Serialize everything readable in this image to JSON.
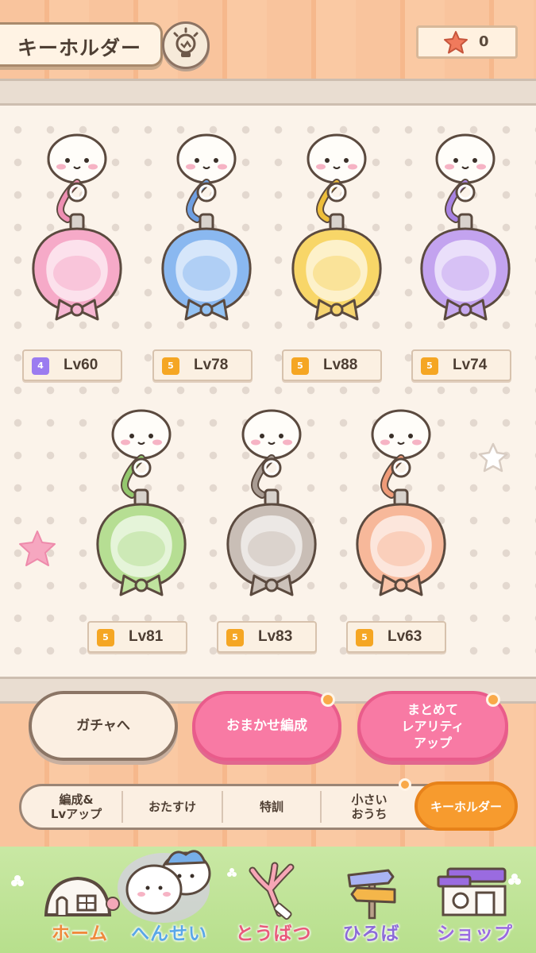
{
  "header": {
    "title": "キーホルダー",
    "currency_value": "0"
  },
  "keyholders_row1": [
    {
      "rarity": "4",
      "level": "Lv60",
      "color": "#f6aac8",
      "ring": "#ee8fb3",
      "bow": "#f6b6d2"
    },
    {
      "rarity": "5",
      "level": "Lv78",
      "color": "#8ab8f0",
      "ring": "#6e9fe2",
      "bow": "#93c2f3"
    },
    {
      "rarity": "5",
      "level": "Lv88",
      "color": "#f8d668",
      "ring": "#eebe3a",
      "bow": "#f6d470"
    },
    {
      "rarity": "5",
      "level": "Lv74",
      "color": "#c3a3ef",
      "ring": "#a883e3",
      "bow": "#c7aaf0"
    }
  ],
  "keyholders_row2": [
    {
      "rarity": "5",
      "level": "Lv81",
      "color": "#b6de93",
      "ring": "#94c86e",
      "bow": "#bfe39e"
    },
    {
      "rarity": "5",
      "level": "Lv83",
      "color": "#c9beb6",
      "ring": "#a99c93",
      "bow": "#cbc1b9"
    },
    {
      "rarity": "5",
      "level": "Lv63",
      "color": "#f7b89a",
      "ring": "#ef9b78",
      "bow": "#f8c2a7"
    }
  ],
  "actions": {
    "gacha": "ガチャへ",
    "auto_form": "おまかせ編成",
    "bulk_rarity_line1": "まとめて",
    "bulk_rarity_line2": "レアリティ",
    "bulk_rarity_line3": "アップ"
  },
  "tabs": {
    "t1_line1": "編成&",
    "t1_line2": "Lvアップ",
    "t2": "おたすけ",
    "t3": "特訓",
    "t4_line1": "小さい",
    "t4_line2": "おうち",
    "active": "キーホルダー"
  },
  "nav": {
    "home": "ホーム",
    "formation": "へんせい",
    "subjugation": "とうばつ",
    "plaza": "ひろば",
    "shop": "ショップ"
  },
  "colors": {
    "rarity4": "#9b7cf0",
    "rarity5": "#f5a623",
    "nav_home": "#ef8a3c",
    "nav_formation": "#5aa7e8",
    "nav_subjugation": "#e85a7a",
    "nav_plaza": "#8c6bd8",
    "nav_shop": "#9a6be0"
  }
}
